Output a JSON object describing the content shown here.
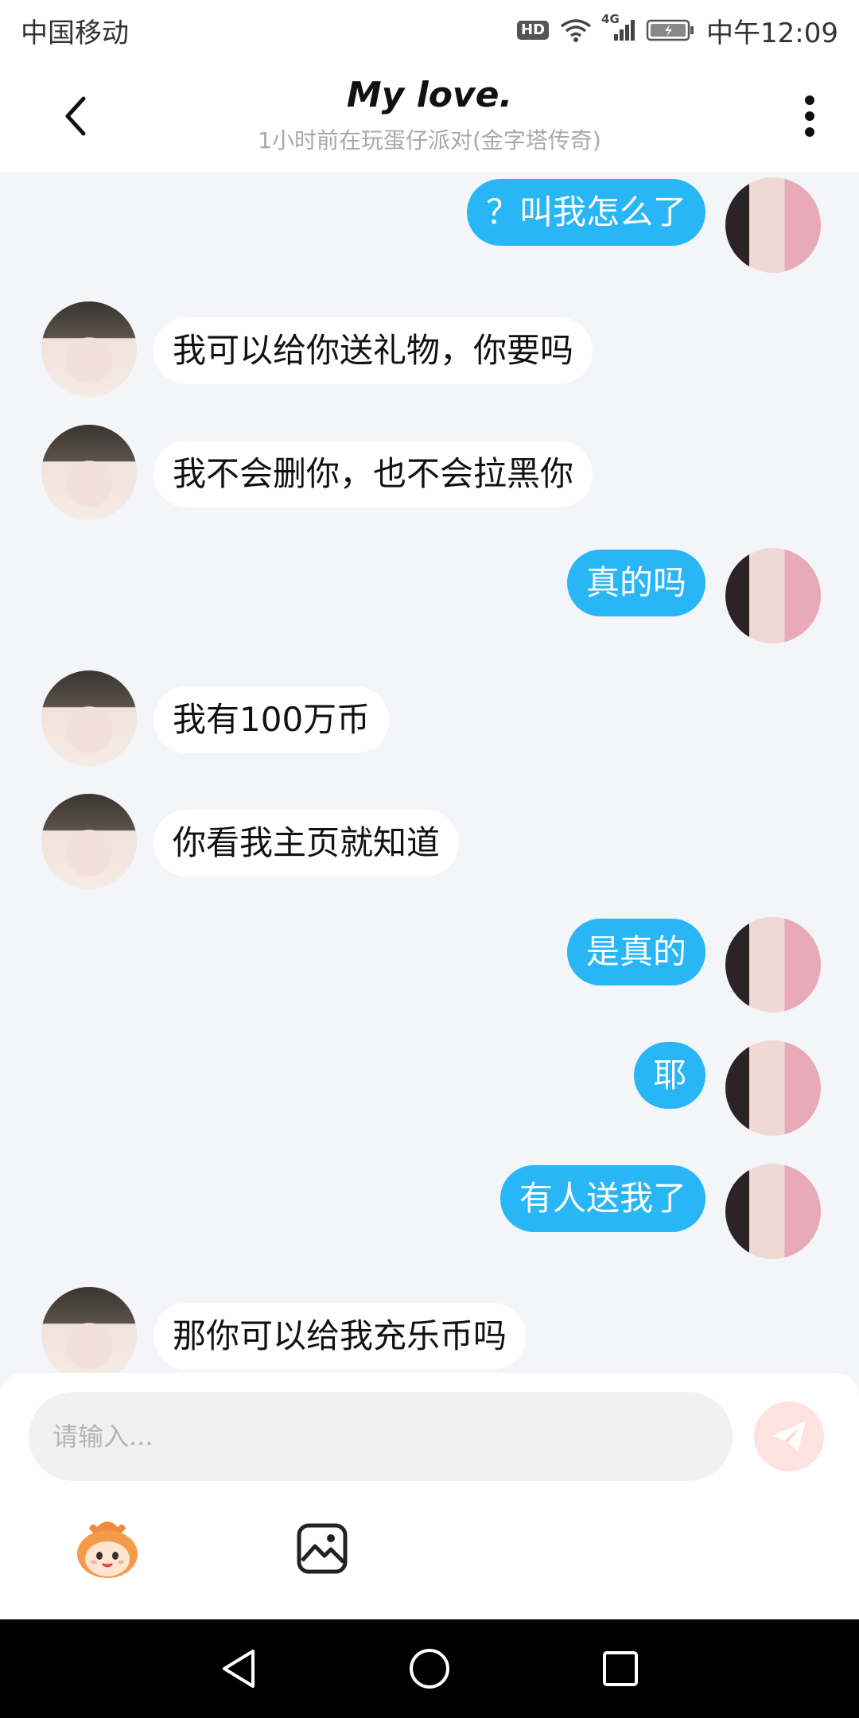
{
  "status_bar": {
    "carrier": "中国移动",
    "hd": "HD",
    "network": "4G",
    "time": "中午12:09"
  },
  "header": {
    "title": "My love.",
    "subtitle": "1小时前在玩蛋仔派对(金字塔传奇)"
  },
  "messages": [
    {
      "side": "right",
      "text": "？叫我怎么了"
    },
    {
      "side": "left",
      "text": "我可以给你送礼物，你要吗"
    },
    {
      "side": "left",
      "text": "我不会删你，也不会拉黑你"
    },
    {
      "side": "right",
      "text": "真的吗"
    },
    {
      "side": "left",
      "text": "我有100万币"
    },
    {
      "side": "left",
      "text": "你看我主页就知道"
    },
    {
      "side": "right",
      "text": "是真的"
    },
    {
      "side": "right",
      "text": "耶"
    },
    {
      "side": "right",
      "text": "有人送我了"
    },
    {
      "side": "left",
      "text": "那你可以给我充乐币吗"
    }
  ],
  "composer": {
    "placeholder": "请输入...",
    "send_icon": "paper-plane-icon",
    "emoji_icon": "eggy-mascot-icon",
    "image_icon": "image-icon"
  },
  "colors": {
    "outgoing_bubble": "#29b6f6",
    "incoming_bubble": "#ffffff",
    "chat_background": "#f3f5f8",
    "send_button": "#fde3df"
  }
}
